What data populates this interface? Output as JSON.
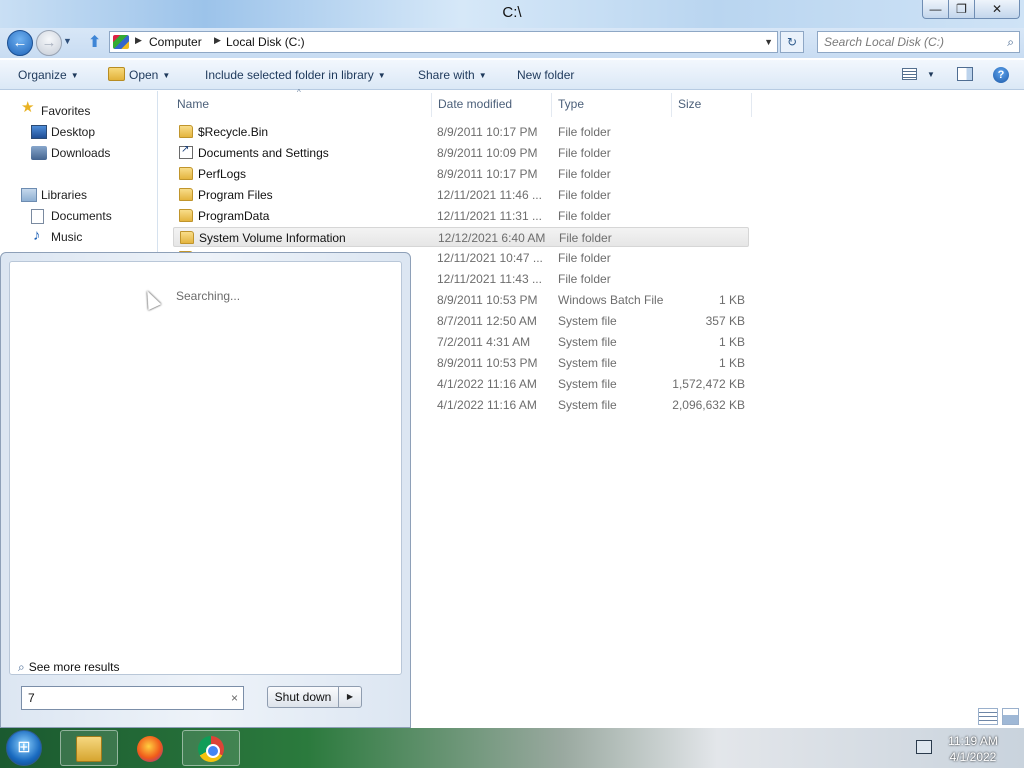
{
  "window": {
    "title": "C:\\",
    "minimize_glyph": "—",
    "maximize_glyph": "❐",
    "close_glyph": "✕"
  },
  "navigation": {
    "back_glyph": "←",
    "forward_glyph": "→",
    "recent_glyph": "▼",
    "up_glyph": "⬆"
  },
  "address": {
    "crumbs": [
      "Computer",
      "Local Disk (C:)"
    ],
    "separator_glyph": "▶",
    "dropdown_glyph": "▼",
    "refresh_glyph": "↻"
  },
  "search": {
    "placeholder": "Search Local Disk (C:)",
    "icon": "search-icon"
  },
  "toolbar": {
    "organize": "Organize",
    "open": "Open",
    "include": "Include selected folder in library",
    "share": "Share with",
    "new_folder": "New folder",
    "dropdown_glyph": "▼",
    "help_glyph": "?"
  },
  "nav_pane": {
    "favorites": "Favorites",
    "desktop": "Desktop",
    "downloads": "Downloads",
    "libraries": "Libraries",
    "documents": "Documents",
    "music": "Music",
    "star_glyph": "★",
    "note_glyph": "♪"
  },
  "columns": {
    "name": "Name",
    "date": "Date modified",
    "type": "Type",
    "size": "Size",
    "sort_glyph": "^"
  },
  "files": [
    {
      "name": "$Recycle.Bin",
      "date": "8/9/2011 10:17 PM",
      "type": "File folder",
      "size": "",
      "icon": "folder",
      "selected": false
    },
    {
      "name": "Documents and Settings",
      "date": "8/9/2011 10:09 PM",
      "type": "File folder",
      "size": "",
      "icon": "link",
      "selected": false
    },
    {
      "name": "PerfLogs",
      "date": "8/9/2011 10:17 PM",
      "type": "File folder",
      "size": "",
      "icon": "folder",
      "selected": false
    },
    {
      "name": "Program Files",
      "date": "12/11/2021 11:46 ...",
      "type": "File folder",
      "size": "",
      "icon": "folder",
      "selected": false
    },
    {
      "name": "ProgramData",
      "date": "12/11/2021 11:31 ...",
      "type": "File folder",
      "size": "",
      "icon": "folder",
      "selected": false
    },
    {
      "name": "System Volume Information",
      "date": "12/12/2021 6:40 AM",
      "type": "File folder",
      "size": "",
      "icon": "folder",
      "selected": true
    },
    {
      "name": "",
      "date": "12/11/2021 10:47 ...",
      "type": "File folder",
      "size": "",
      "icon": "folder",
      "selected": false
    },
    {
      "name": "",
      "date": "12/11/2021 11:43 ...",
      "type": "File folder",
      "size": "",
      "icon": "folder",
      "selected": false
    },
    {
      "name": "",
      "date": "8/9/2011 10:53 PM",
      "type": "Windows Batch File",
      "size": "1 KB",
      "icon": "",
      "selected": false
    },
    {
      "name": "",
      "date": "8/7/2011 12:50 AM",
      "type": "System file",
      "size": "357 KB",
      "icon": "",
      "selected": false
    },
    {
      "name": "",
      "date": "7/2/2011 4:31 AM",
      "type": "System file",
      "size": "1 KB",
      "icon": "",
      "selected": false
    },
    {
      "name": "",
      "date": "8/9/2011 10:53 PM",
      "type": "System file",
      "size": "1 KB",
      "icon": "",
      "selected": false
    },
    {
      "name": "",
      "date": "4/1/2022 11:16 AM",
      "type": "System file",
      "size": "1,572,472 KB",
      "icon": "",
      "selected": false
    },
    {
      "name": "",
      "date": "4/1/2022 11:16 AM",
      "type": "System file",
      "size": "2,096,632 KB",
      "icon": "",
      "selected": false
    }
  ],
  "start_menu": {
    "status": "Searching...",
    "see_more": "See more results",
    "search_value": "7",
    "clear_glyph": "×",
    "shutdown": "Shut down",
    "shutdown_arrow": "▶"
  },
  "taskbar": {
    "start_glyph": "⊞",
    "apps": [
      "windows-explorer",
      "firefox",
      "chrome"
    ],
    "clock_time": "11:19 AM",
    "clock_date": "4/1/2022"
  }
}
